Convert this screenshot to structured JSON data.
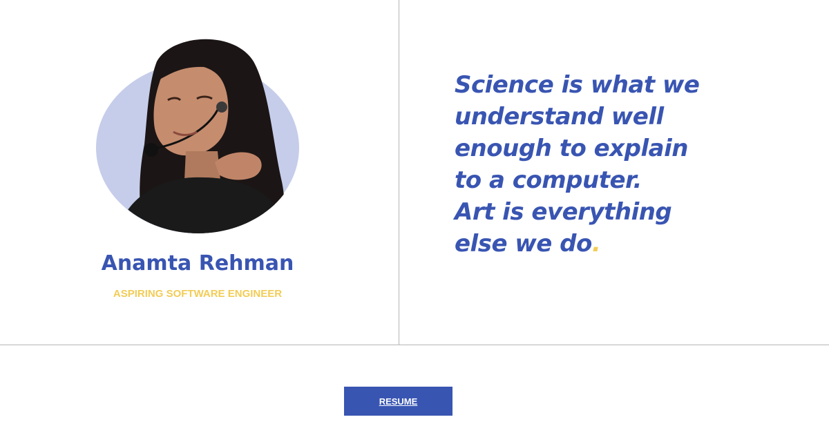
{
  "profile": {
    "name": "Anamta Rehman",
    "role": "ASPIRING SOFTWARE ENGINEER",
    "photo_alt": "profile-photo"
  },
  "quote": {
    "lines": [
      "Science is what we",
      "understand well",
      "enough to explain",
      "to a computer.",
      "Art is everything",
      "else we do"
    ],
    "ending_punctuation": "."
  },
  "actions": {
    "resume_label": "RESUME"
  },
  "colors": {
    "accent_blue": "#3955b2",
    "accent_yellow": "#f2cc55",
    "avatar_bg": "#c5cdea",
    "divider": "#b5b5b5"
  }
}
